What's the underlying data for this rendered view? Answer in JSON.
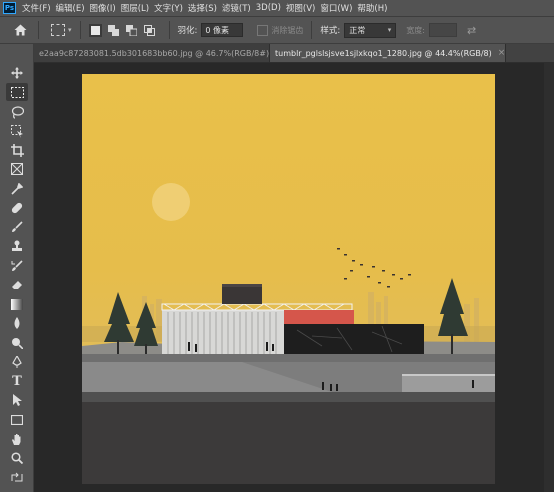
{
  "app": {
    "logo_text": "Ps"
  },
  "menu": [
    "文件(F)",
    "编辑(E)",
    "图像(I)",
    "图层(L)",
    "文字(Y)",
    "选择(S)",
    "滤镜(T)",
    "3D(D)",
    "视图(V)",
    "窗口(W)",
    "帮助(H)"
  ],
  "options": {
    "feather_label": "羽化:",
    "feather_value": "0 像素",
    "antialias_label": "消除锯齿",
    "style_label": "样式:",
    "style_value": "正常",
    "width_label": "宽度:"
  },
  "tabs": [
    {
      "label": "e2aa9c87283081.5db301683bb60.jpg @ 46.7%(RGB/8#)",
      "active": false
    },
    {
      "label": "tumblr_pglslsjsve1sjlxkqo1_1280.jpg @ 44.4%(RGB/8)",
      "active": true
    }
  ],
  "tools": [
    "move-tool-icon",
    "rectangular-marquee-icon",
    "lasso-icon",
    "object-select-icon",
    "crop-icon",
    "frame-icon",
    "eyedropper-icon",
    "healing-brush-icon",
    "brush-icon",
    "clone-stamp-icon",
    "history-brush-icon",
    "eraser-icon",
    "gradient-icon",
    "blur-icon",
    "dodge-icon",
    "pen-icon",
    "type-icon",
    "path-selection-icon",
    "rectangle-icon",
    "hand-icon",
    "zoom-icon",
    "swap-colors-icon"
  ],
  "colors": {
    "ui_panel": "#535353",
    "workspace": "#282828",
    "sky": "#e7bf4b",
    "sun": "#f0d17a",
    "ground_dark": "#3c3a3a",
    "accent_red": "#d5564b"
  }
}
